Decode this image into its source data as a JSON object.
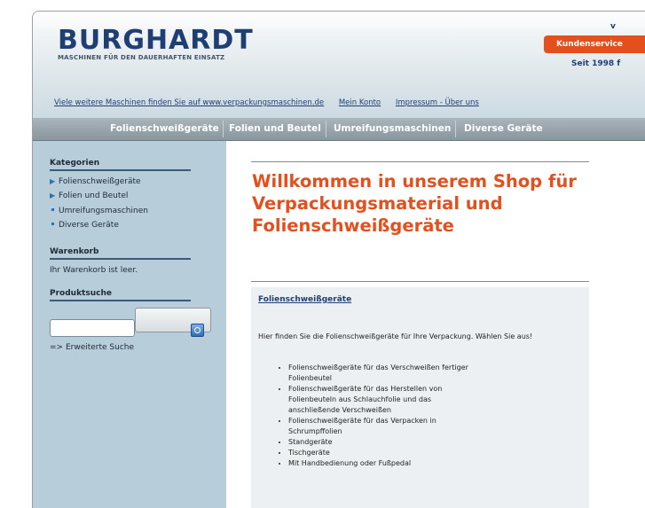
{
  "brand": {
    "logo_text": "BURGHARDT",
    "tagline": "MASCHINEN FÜR DEN DAUERHAFTEN EINSATZ",
    "top_right_fragment": "v",
    "service_label": "Kundenservice",
    "since_text": "Seit 1998 f"
  },
  "top_links": [
    "Viele weitere Maschinen finden Sie auf www.verpackungsmaschinen.de",
    "Mein Konto",
    "Impressum - Über uns"
  ],
  "nav": [
    "Folienschweißgeräte",
    "Folien und Beutel",
    "Umreifungsmaschinen",
    "Diverse Geräte"
  ],
  "sidebar": {
    "categories_title": "Kategorien",
    "categories": [
      {
        "label": "Folienschweißgeräte",
        "marker": "arrow"
      },
      {
        "label": "Folien und Beutel",
        "marker": "arrow"
      },
      {
        "label": "Umreifungsmaschinen",
        "marker": "square"
      },
      {
        "label": "Diverse Geräte",
        "marker": "square"
      }
    ],
    "cart_title": "Warenkorb",
    "cart_text": "Ihr Warenkorb ist leer.",
    "search_title": "Produktsuche",
    "search_value": "",
    "advanced_search": "=> Erweiterte Suche"
  },
  "main": {
    "welcome": "Willkommen in unserem Shop für Verpackungsmaterial und Folienschweißgeräte",
    "box_title": "Folienschweißgeräte",
    "box_intro": "Hier finden Sie die Folienschweißgeräte für Ihre Verpackung. Wählen Sie aus!",
    "box_items": [
      "Folienschweißgeräte für das Verschweißen fertiger Folienbeutel",
      "Folienschweißgeräte für das Herstellen von Folienbeuteln aus Schlauchfolie und das anschließende Verschweißen",
      "Folienschweißgeräte für das Verpacken in Schrumpffolien",
      "Standgeräte",
      "Tischgeräte",
      "Mit Handbedienung oder Fußpedal"
    ]
  },
  "colors": {
    "brand_blue": "#1f3f73",
    "accent_orange": "#e4501d",
    "sidebar_bg": "#b7cdd9",
    "nav_bg": "#8a969e"
  }
}
